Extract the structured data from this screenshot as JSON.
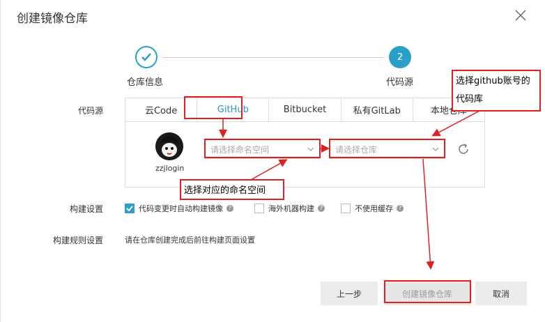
{
  "dialog": {
    "title": "创建镜像仓库"
  },
  "steps": [
    {
      "label": "仓库信息",
      "state": "done"
    },
    {
      "label": "代码源",
      "number": "2",
      "state": "active"
    }
  ],
  "form": {
    "code_source_label": "代码源",
    "tabs": [
      "云Code",
      "GitHub",
      "Bitbucket",
      "私有GitLab",
      "本地仓库"
    ],
    "active_tab": "GitHub",
    "username": "zzjlogin",
    "namespace_placeholder": "请选择命名空间",
    "repo_placeholder": "请选择仓库",
    "build_settings_label": "构建设置",
    "build_options": [
      {
        "label": "代码变更时自动构建镜像",
        "checked": true
      },
      {
        "label": "海外机器构建",
        "checked": false
      },
      {
        "label": "不使用缓存",
        "checked": false
      }
    ],
    "build_rules_label": "构建规则设置",
    "build_rules_text": "请在仓库创建完成后前往构建页面设置"
  },
  "buttons": {
    "prev": "上一步",
    "create": "创建镜像仓库",
    "cancel": "取消"
  },
  "annotations": {
    "github_account": "选择github账号的代码库",
    "github_account_line1": "选择github账号的",
    "github_account_line2": "代码库",
    "namespace": "选择对应的命名空间"
  },
  "colors": {
    "accent": "#2aa0c8",
    "annotation": "#e02020"
  }
}
